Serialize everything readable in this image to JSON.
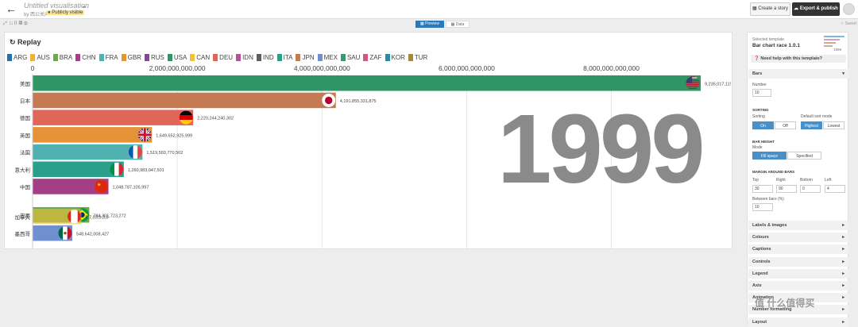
{
  "topbar": {
    "title": "Untitled visualisation",
    "byline": "by 西公关声",
    "visibility": "Publicly visible",
    "create_story": "Create a story",
    "export_publish": "Export & publish"
  },
  "subbar": {
    "preview_tab": "Preview",
    "data_tab": "Data",
    "saved": "Saved"
  },
  "chart": {
    "replay_label": "Replay",
    "year_label": "1999"
  },
  "chart_data": {
    "type": "bar",
    "title": "",
    "year": "1999",
    "xlim": [
      0,
      9235017115000
    ],
    "x_ticks": [
      0,
      2000000000000,
      4000000000000,
      6000000000000,
      8000000000000
    ],
    "x_tick_labels": [
      "0",
      "2,000,000,000,000",
      "4,000,000,000,000",
      "6,000,000,000,000",
      "8,000,000,000,000"
    ],
    "legend": [
      {
        "code": "ARG",
        "color": "#2a6fa5"
      },
      {
        "code": "AUS",
        "color": "#f0b23a"
      },
      {
        "code": "BRA",
        "color": "#6fa84c"
      },
      {
        "code": "CHN",
        "color": "#a43f86"
      },
      {
        "code": "FRA",
        "color": "#4fb1b0"
      },
      {
        "code": "GBR",
        "color": "#e69236"
      },
      {
        "code": "RUS",
        "color": "#7f4b8d"
      },
      {
        "code": "USA",
        "color": "#2f9565"
      },
      {
        "code": "CAN",
        "color": "#f2c23c"
      },
      {
        "code": "DEU",
        "color": "#e0665a"
      },
      {
        "code": "IDN",
        "color": "#b05697"
      },
      {
        "code": "IND",
        "color": "#5e5e5e"
      },
      {
        "code": "ITA",
        "color": "#2aa08a"
      },
      {
        "code": "JPN",
        "color": "#c57a52"
      },
      {
        "code": "MEX",
        "color": "#6f8fcf"
      },
      {
        "code": "SAU",
        "color": "#3a9a6b"
      },
      {
        "code": "ZAF",
        "color": "#d05a7e"
      },
      {
        "code": "KOR",
        "color": "#2a8ca5"
      },
      {
        "code": "TUR",
        "color": "#a6873f"
      }
    ],
    "bars": [
      {
        "label": "美国",
        "value": 9235017115000,
        "value_label": "9,235,017,11!",
        "color": "#2f9565",
        "flag": "USA"
      },
      {
        "label": "日本",
        "value": 4191855331875,
        "value_label": "4,191,855,331,875",
        "color": "#c57a52",
        "flag": "JPN"
      },
      {
        "label": "德国",
        "value": 2220244240302,
        "value_label": "2,220,244,240,302",
        "color": "#e0665a",
        "flag": "DEU"
      },
      {
        "label": "英国",
        "value": 1649652925999,
        "value_label": "1,649,652,925,999",
        "color": "#e69236",
        "flag": "GBR"
      },
      {
        "label": "法国",
        "value": 1519560770502,
        "value_label": "1,519,560,770,502",
        "color": "#4fb1b0",
        "flag": "FRA"
      },
      {
        "label": "意大利",
        "value": 1260983047501,
        "value_label": "1,260,983,047,501",
        "color": "#2aa08a",
        "flag": "ITA"
      },
      {
        "label": "中国",
        "value": 1048787105997,
        "value_label": "1,048,787,105,997",
        "color": "#a43f86",
        "flag": "CHN"
      },
      {
        "label": "巴西",
        "value": 784301723272,
        "value_label": "784,301,723,272",
        "color": "#6fa84c",
        "flag": "BRA"
      },
      {
        "label": "加拿大",
        "value": 675000000000,
        "value_label": "6,7,03,0,3,8",
        "color": "#f2c23c",
        "flag": "CAN"
      },
      {
        "label": "墨西哥",
        "value": 548642008427,
        "value_label": "548,642,008,427",
        "color": "#6f8fcf",
        "flag": "MEX"
      }
    ]
  },
  "panel": {
    "selected_template_label": "Selected template",
    "template_name": "Bar chart race 1.0.1",
    "thumb_year": "1999",
    "help_label": "Need help with this template?",
    "bars_section": "Bars",
    "number_label": "Number",
    "number_value": "10",
    "sorting_head": "SORTING",
    "sorting_label": "Sorting",
    "sort_on": "On",
    "sort_off": "Off",
    "default_sort_label": "Default sort mode",
    "sort_highest": "Highest",
    "sort_lowest": "Lowest",
    "bar_height_head": "BAR HEIGHT",
    "mode_label": "Mode",
    "fill_space": "Fill space",
    "specified": "Specified",
    "margin_head": "MARGIN AROUND BARS",
    "top_label": "Top",
    "top_value": "30",
    "right_label": "Right",
    "right_value": "90",
    "bottom_label": "Bottom",
    "bottom_value": "0",
    "left_label": "Left",
    "left_value": "4",
    "between_label": "Between bars (%)",
    "between_value": "10",
    "sections": [
      "Labels & images",
      "Colours",
      "Captions",
      "Controls",
      "Legend",
      "Axis",
      "Animation",
      "Number formatting",
      "Layout"
    ]
  },
  "watermark": "值 什么值得买"
}
